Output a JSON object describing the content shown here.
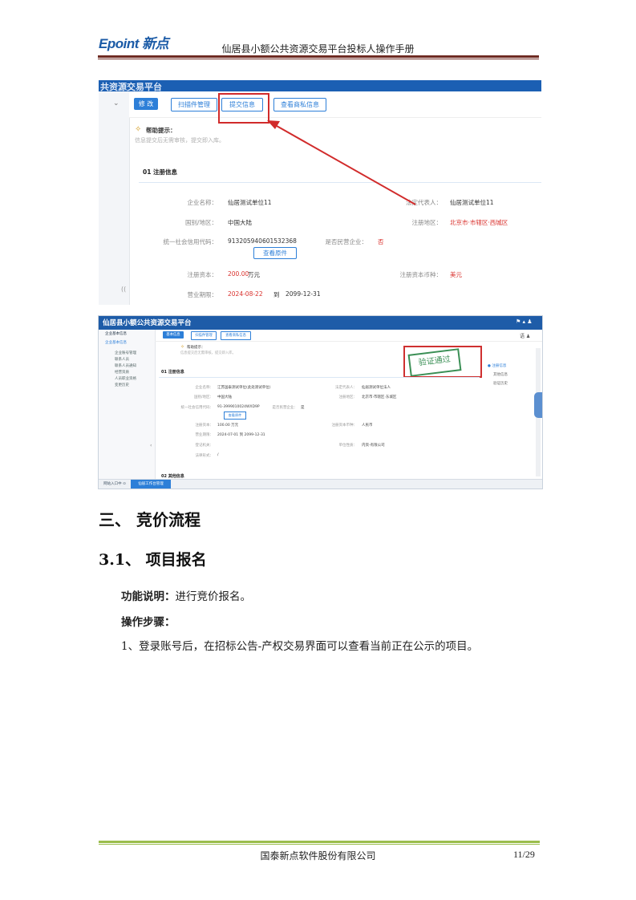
{
  "header": {
    "logo": "Epoint 新点",
    "title": "仙居县小额公共资源交易平台投标人操作手册"
  },
  "shot1": {
    "bar_title": "共资源交易平台",
    "buttons": [
      "修 改",
      "扫描件管理",
      "提交信息",
      "查看商私信息"
    ],
    "help_title": "帮助提示：",
    "help_text": "信息提交后无需审核，提交即入库。",
    "section": "01   注册信息",
    "fields": {
      "company_label": "企业名称：",
      "company_value": "仙居测试单位11",
      "legal_label": "法定代表人：",
      "legal_value": "仙居测试单位11",
      "country_label": "国别/地区：",
      "country_value": "中国大陆",
      "region_label": "注册地区：",
      "region_value": "北京市·市辖区·西城区",
      "credit_label": "统一社会信用代码：",
      "credit_value": "913205940601532368",
      "private_label": "是否民营企业：",
      "private_value": "否",
      "view_btn": "查看原件",
      "capital_label": "注册资本：",
      "capital_value": "200.00",
      "capital_unit": "万元",
      "currency_label": "注册资本币种：",
      "currency_value": "美元",
      "period_label": "营业期限：",
      "period_start": "2024-08-22",
      "period_to": "到",
      "period_end": "2099-12-31"
    },
    "side_mark": "(("
  },
  "shot2": {
    "title": "仙居县小额公共资源交易平台",
    "buttons": [
      "基本信息",
      "扫描件管理",
      "查看商私信息"
    ],
    "side_items": [
      "企业基本信息",
      "企业基本信息",
      "企业账号管理",
      "联系人员",
      "联系人员通知",
      "经营资质",
      "人员职业资格",
      "变更历史"
    ],
    "help_title": "帮助提示：",
    "help_text": "信息提交后无需审核，提交即入库。",
    "stamp": "验证通过",
    "section": "01  注册信息",
    "right_nav": [
      "注册信息",
      "其他信息",
      "验证历史"
    ],
    "rows": [
      [
        "企业名称：",
        "江苏国泰测试单位(此处测试单位)",
        "法定代表人：",
        "仙居测试单位法人"
      ],
      [
        "国别/地区：",
        "中国大陆",
        "注册地区：",
        "北京市·市辖区·东城区"
      ],
      [
        "统一社会信用代码：",
        "91-3999010024WXD9P",
        "是否民营企业：",
        "是"
      ],
      [
        "注册资本：",
        "100.00 万元",
        "注册资本币种：",
        "人民币"
      ],
      [
        "营业期限：",
        "2024-07-01    到    2099-12-31",
        "",
        ""
      ],
      [
        "登记机关：",
        "",
        "单位性质：",
        "内资-有限公司"
      ],
      [
        "法律形式：",
        "/",
        "",
        ""
      ]
    ],
    "view_btn": "查看原件",
    "section2": "02  其他信息",
    "tabs": [
      "网站入口中 ⊙",
      "仙居工作台管理"
    ],
    "top_right": "语 ♟"
  },
  "body": {
    "h1": "三、  竞价流程",
    "h2": "3.1、  项目报名",
    "p1_bold": "功能说明：",
    "p1_text": "进行竞价报名。",
    "p2_bold": "操作步骤：",
    "p3": "1、登录账号后，在招标公告-产权交易界面可以查看当前正在公示的项目。"
  },
  "footer": {
    "company": "国泰新点软件股份有限公司",
    "page": "11/29"
  },
  "colors": {
    "brand": "#1a5aa6",
    "header_line": "#6e2a22",
    "footer_line": "#9bbd4c",
    "highlight_red": "#d12b2b"
  }
}
